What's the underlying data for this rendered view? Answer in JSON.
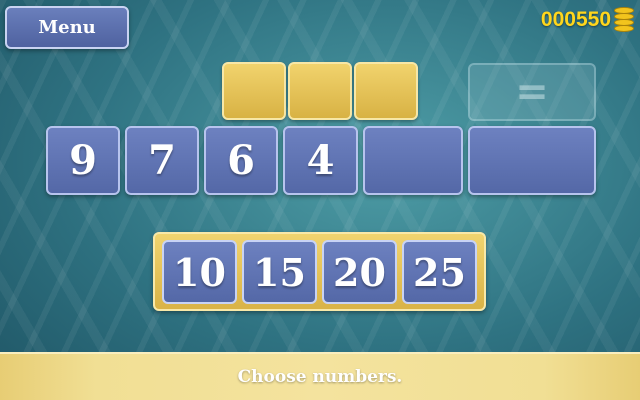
{
  "menu_label": "Menu",
  "score": "000550",
  "coin_icon": "coin-stack-icon",
  "operator_slots": [
    "",
    "",
    ""
  ],
  "equals_symbol": "=",
  "number_row": [
    "9",
    "7",
    "6",
    "4",
    "",
    ""
  ],
  "choices": [
    "10",
    "15",
    "20",
    "25"
  ],
  "status": "Choose numbers.",
  "colors": {
    "tile_blue": "#5f73b3",
    "slot_gold": "#e4c45a",
    "score_yellow": "#ffd61c",
    "background_teal": "#2f7382"
  }
}
